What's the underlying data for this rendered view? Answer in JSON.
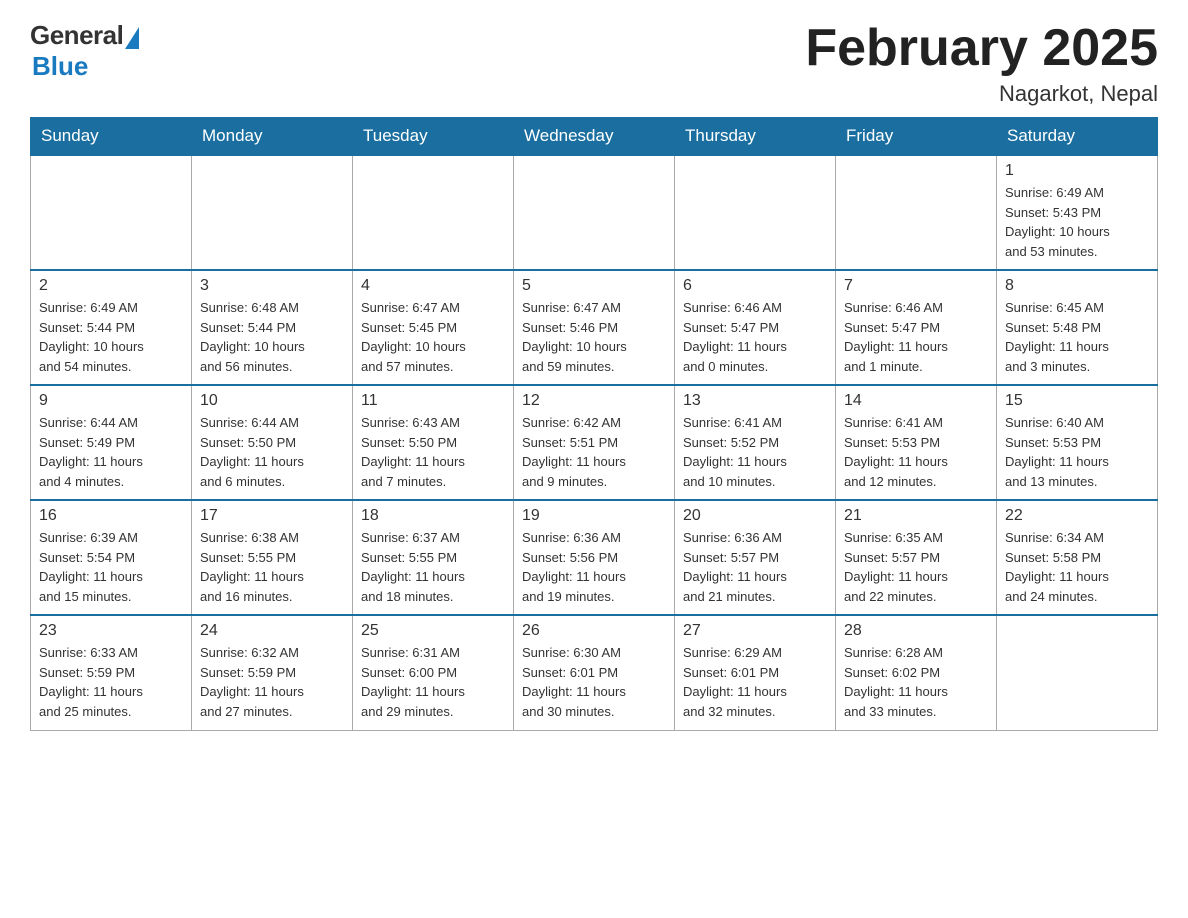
{
  "header": {
    "logo_general": "General",
    "logo_blue": "Blue",
    "title": "February 2025",
    "subtitle": "Nagarkot, Nepal"
  },
  "weekdays": [
    "Sunday",
    "Monday",
    "Tuesday",
    "Wednesday",
    "Thursday",
    "Friday",
    "Saturday"
  ],
  "weeks": [
    [
      {
        "day": "",
        "info": ""
      },
      {
        "day": "",
        "info": ""
      },
      {
        "day": "",
        "info": ""
      },
      {
        "day": "",
        "info": ""
      },
      {
        "day": "",
        "info": ""
      },
      {
        "day": "",
        "info": ""
      },
      {
        "day": "1",
        "info": "Sunrise: 6:49 AM\nSunset: 5:43 PM\nDaylight: 10 hours\nand 53 minutes."
      }
    ],
    [
      {
        "day": "2",
        "info": "Sunrise: 6:49 AM\nSunset: 5:44 PM\nDaylight: 10 hours\nand 54 minutes."
      },
      {
        "day": "3",
        "info": "Sunrise: 6:48 AM\nSunset: 5:44 PM\nDaylight: 10 hours\nand 56 minutes."
      },
      {
        "day": "4",
        "info": "Sunrise: 6:47 AM\nSunset: 5:45 PM\nDaylight: 10 hours\nand 57 minutes."
      },
      {
        "day": "5",
        "info": "Sunrise: 6:47 AM\nSunset: 5:46 PM\nDaylight: 10 hours\nand 59 minutes."
      },
      {
        "day": "6",
        "info": "Sunrise: 6:46 AM\nSunset: 5:47 PM\nDaylight: 11 hours\nand 0 minutes."
      },
      {
        "day": "7",
        "info": "Sunrise: 6:46 AM\nSunset: 5:47 PM\nDaylight: 11 hours\nand 1 minute."
      },
      {
        "day": "8",
        "info": "Sunrise: 6:45 AM\nSunset: 5:48 PM\nDaylight: 11 hours\nand 3 minutes."
      }
    ],
    [
      {
        "day": "9",
        "info": "Sunrise: 6:44 AM\nSunset: 5:49 PM\nDaylight: 11 hours\nand 4 minutes."
      },
      {
        "day": "10",
        "info": "Sunrise: 6:44 AM\nSunset: 5:50 PM\nDaylight: 11 hours\nand 6 minutes."
      },
      {
        "day": "11",
        "info": "Sunrise: 6:43 AM\nSunset: 5:50 PM\nDaylight: 11 hours\nand 7 minutes."
      },
      {
        "day": "12",
        "info": "Sunrise: 6:42 AM\nSunset: 5:51 PM\nDaylight: 11 hours\nand 9 minutes."
      },
      {
        "day": "13",
        "info": "Sunrise: 6:41 AM\nSunset: 5:52 PM\nDaylight: 11 hours\nand 10 minutes."
      },
      {
        "day": "14",
        "info": "Sunrise: 6:41 AM\nSunset: 5:53 PM\nDaylight: 11 hours\nand 12 minutes."
      },
      {
        "day": "15",
        "info": "Sunrise: 6:40 AM\nSunset: 5:53 PM\nDaylight: 11 hours\nand 13 minutes."
      }
    ],
    [
      {
        "day": "16",
        "info": "Sunrise: 6:39 AM\nSunset: 5:54 PM\nDaylight: 11 hours\nand 15 minutes."
      },
      {
        "day": "17",
        "info": "Sunrise: 6:38 AM\nSunset: 5:55 PM\nDaylight: 11 hours\nand 16 minutes."
      },
      {
        "day": "18",
        "info": "Sunrise: 6:37 AM\nSunset: 5:55 PM\nDaylight: 11 hours\nand 18 minutes."
      },
      {
        "day": "19",
        "info": "Sunrise: 6:36 AM\nSunset: 5:56 PM\nDaylight: 11 hours\nand 19 minutes."
      },
      {
        "day": "20",
        "info": "Sunrise: 6:36 AM\nSunset: 5:57 PM\nDaylight: 11 hours\nand 21 minutes."
      },
      {
        "day": "21",
        "info": "Sunrise: 6:35 AM\nSunset: 5:57 PM\nDaylight: 11 hours\nand 22 minutes."
      },
      {
        "day": "22",
        "info": "Sunrise: 6:34 AM\nSunset: 5:58 PM\nDaylight: 11 hours\nand 24 minutes."
      }
    ],
    [
      {
        "day": "23",
        "info": "Sunrise: 6:33 AM\nSunset: 5:59 PM\nDaylight: 11 hours\nand 25 minutes."
      },
      {
        "day": "24",
        "info": "Sunrise: 6:32 AM\nSunset: 5:59 PM\nDaylight: 11 hours\nand 27 minutes."
      },
      {
        "day": "25",
        "info": "Sunrise: 6:31 AM\nSunset: 6:00 PM\nDaylight: 11 hours\nand 29 minutes."
      },
      {
        "day": "26",
        "info": "Sunrise: 6:30 AM\nSunset: 6:01 PM\nDaylight: 11 hours\nand 30 minutes."
      },
      {
        "day": "27",
        "info": "Sunrise: 6:29 AM\nSunset: 6:01 PM\nDaylight: 11 hours\nand 32 minutes."
      },
      {
        "day": "28",
        "info": "Sunrise: 6:28 AM\nSunset: 6:02 PM\nDaylight: 11 hours\nand 33 minutes."
      },
      {
        "day": "",
        "info": ""
      }
    ]
  ]
}
